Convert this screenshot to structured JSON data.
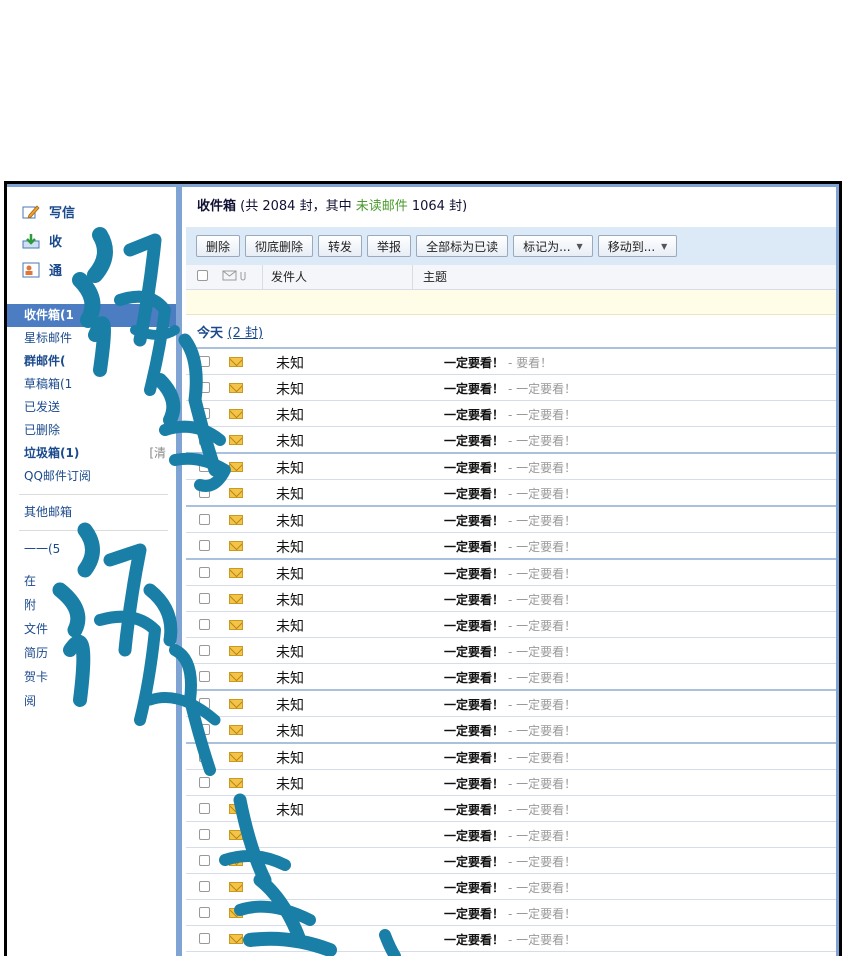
{
  "sidebar": {
    "actions": [
      {
        "label": "写信",
        "icon": "pencil-icon"
      },
      {
        "label": "收",
        "icon": "inbox-download-icon"
      },
      {
        "label": "通",
        "icon": "contacts-icon"
      }
    ],
    "folders": [
      {
        "label": "收件箱(1",
        "active": true
      },
      {
        "label": "星标邮件"
      },
      {
        "label": "群邮件(",
        "bold": true
      },
      {
        "label": "草稿箱(1"
      },
      {
        "label": "已发送"
      },
      {
        "label": "已删除"
      },
      {
        "label": "垃圾箱(1)",
        "bold": true,
        "extra": "[清"
      },
      {
        "label": "QQ邮件订阅"
      }
    ],
    "other_mailbox": "其他邮箱",
    "tools": [
      {
        "label": "一一(5"
      },
      {
        "label": "在"
      },
      {
        "label": "附"
      },
      {
        "label": "文件"
      },
      {
        "label": "简历"
      },
      {
        "label": "贺卡"
      },
      {
        "label": "阅"
      }
    ]
  },
  "summary": {
    "folder": "收件箱",
    "prefix": " (共 2084 封，其中 ",
    "unread_label": "未读邮件",
    "suffix": " 1064 封)"
  },
  "toolbar": {
    "delete": "删除",
    "delete_permanent": "彻底删除",
    "forward": "转发",
    "report": "举报",
    "mark_all_read": "全部标为已读",
    "mark_as": "标记为...",
    "move_to": "移动到..."
  },
  "columns": {
    "sender": "发件人",
    "subject": "主题"
  },
  "group": {
    "label": "今天",
    "count": "(2 封)"
  },
  "emails": [
    {
      "sender": "未知",
      "subject": "一定要看！",
      "preview": "-     要看！"
    },
    {
      "sender": "未知",
      "subject": "一定要看！",
      "preview": "- 一定要看！"
    },
    {
      "sender": "未知",
      "subject": "一定要看！",
      "preview": "- 一定要看！"
    },
    {
      "sender": "未知",
      "subject": "一定要看！",
      "preview": "- 一定要看！"
    },
    {
      "sender": "未知",
      "subject": "一定要看！",
      "preview": "- 一定要看！"
    },
    {
      "sender": "未知",
      "subject": "一定要看！",
      "preview": "- 一定要看！"
    },
    {
      "sender": "未知",
      "subject": "一定要看！",
      "preview": "- 一定要看！"
    },
    {
      "sender": "未知",
      "subject": "一定要看！",
      "preview": "- 一定要看！"
    },
    {
      "sender": "未知",
      "subject": "一定要看！",
      "preview": "- 一定要看！"
    },
    {
      "sender": "未知",
      "subject": "一定要看！",
      "preview": "- 一定要看！"
    },
    {
      "sender": "未知",
      "subject": "一定要看！",
      "preview": "- 一定要看！"
    },
    {
      "sender": "未知",
      "subject": "一定要看！",
      "preview": "- 一定要看！"
    },
    {
      "sender": "未知",
      "subject": "一定要看！",
      "preview": "- 一定要看！"
    },
    {
      "sender": "未知",
      "subject": "一定要看！",
      "preview": "- 一定要看！"
    },
    {
      "sender": "未知",
      "subject": "一定要看！",
      "preview": "- 一定要看！"
    },
    {
      "sender": "未知",
      "subject": "一定要看！",
      "preview": "- 一定要看！"
    },
    {
      "sender": "未知",
      "subject": "一定要看！",
      "preview": "- 一定要看！"
    },
    {
      "sender": "未知",
      "subject": "一定要看！",
      "preview": "- 一定要看！"
    },
    {
      "sender": "",
      "subject": "一定要看！",
      "preview": "- 一定要看！"
    },
    {
      "sender": "",
      "subject": "一定要看！",
      "preview": "- 一定要看！"
    },
    {
      "sender": "",
      "subject": "一定要看！",
      "preview": "- 一定要看！"
    },
    {
      "sender": "",
      "subject": "一定要看！",
      "preview": "- 一定要看！"
    },
    {
      "sender": "",
      "subject": "一定要看！",
      "preview": "- 一定要看！"
    },
    {
      "sender": "",
      "subject": "一定要看！",
      "preview": "- 一定要看！"
    }
  ],
  "colors": {
    "frame": "#7fa4d4",
    "active_folder": "#4c7cc2",
    "toolbar_bg": "#dce9f7",
    "graffiti": "#1a7fa6"
  }
}
